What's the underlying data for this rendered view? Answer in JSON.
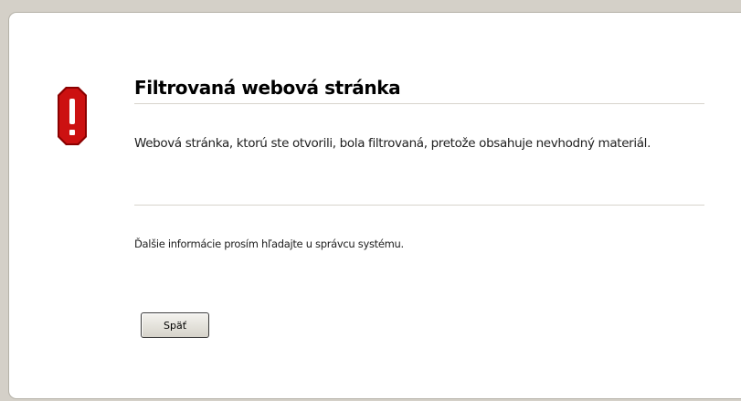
{
  "icon": "stop-warning-icon",
  "colors": {
    "icon_fill": "#cc1111",
    "icon_border": "#8a0000",
    "background": "#d4d0c8",
    "panel": "#ffffff"
  },
  "page": {
    "title": "Filtrovaná webová stránka",
    "message": "Webová stránka, ktorú ste otvorili, bola filtrovaná, pretože obsahuje nevhodný materiál.",
    "info": "Ďalšie informácie prosím hľadajte u správcu systému.",
    "back_label": "Späť"
  }
}
